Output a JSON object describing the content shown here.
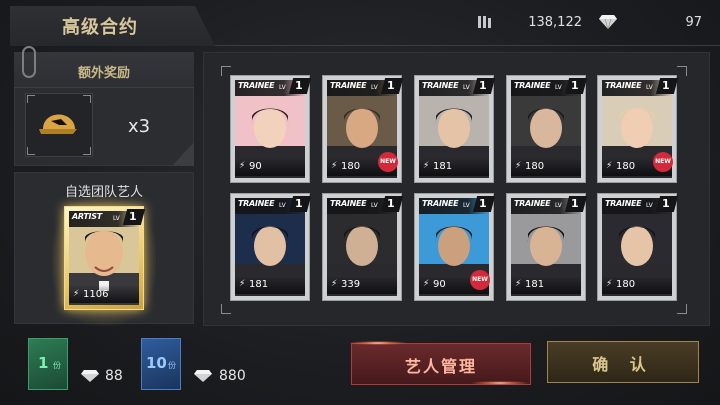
{
  "header": {
    "title": "高级合约",
    "currency_1_icon": "stack-icon",
    "currency_1_value": "138,122",
    "currency_2_icon": "diamond-icon",
    "currency_2_value": "97"
  },
  "bonus": {
    "label": "额外奖励",
    "reward_icon": "cap-icon",
    "reward_qty": "x3"
  },
  "featured": {
    "label": "自选团队艺人",
    "card": {
      "brand": "ARTIST",
      "lv_label": "LV",
      "lv": "1",
      "power": "1106"
    }
  },
  "cards": [
    {
      "brand": "TRAINEE",
      "lv_label": "LV",
      "lv": "1",
      "power": "90",
      "new": false,
      "new_label": ""
    },
    {
      "brand": "TRAINEE",
      "lv_label": "LV",
      "lv": "1",
      "power": "180",
      "new": true,
      "new_label": "NEW"
    },
    {
      "brand": "TRAINEE",
      "lv_label": "LV",
      "lv": "1",
      "power": "181",
      "new": false,
      "new_label": ""
    },
    {
      "brand": "TRAINEE",
      "lv_label": "LV",
      "lv": "1",
      "power": "180",
      "new": false,
      "new_label": ""
    },
    {
      "brand": "TRAINEE",
      "lv_label": "LV",
      "lv": "1",
      "power": "180",
      "new": true,
      "new_label": "NEW"
    },
    {
      "brand": "TRAINEE",
      "lv_label": "LV",
      "lv": "1",
      "power": "181",
      "new": false,
      "new_label": ""
    },
    {
      "brand": "TRAINEE",
      "lv_label": "LV",
      "lv": "1",
      "power": "339",
      "new": false,
      "new_label": ""
    },
    {
      "brand": "TRAINEE",
      "lv_label": "LV",
      "lv": "1",
      "power": "90",
      "new": true,
      "new_label": "NEW"
    },
    {
      "brand": "TRAINEE",
      "lv_label": "LV",
      "lv": "1",
      "power": "181",
      "new": false,
      "new_label": ""
    },
    {
      "brand": "TRAINEE",
      "lv_label": "LV",
      "lv": "1",
      "power": "180",
      "new": false,
      "new_label": ""
    }
  ],
  "packs": [
    {
      "num": "1",
      "unit": "份",
      "price": "88",
      "color": "#2e7c55"
    },
    {
      "num": "10",
      "unit": "份",
      "price": "880",
      "color": "#2f5d9e"
    }
  ],
  "buttons": {
    "manage_label": "艺人管理",
    "confirm_label": "确 认"
  },
  "colors": {
    "accent_gold": "#d8c79a",
    "accent_red": "#b5383b",
    "new_badge": "#d22a3b"
  }
}
